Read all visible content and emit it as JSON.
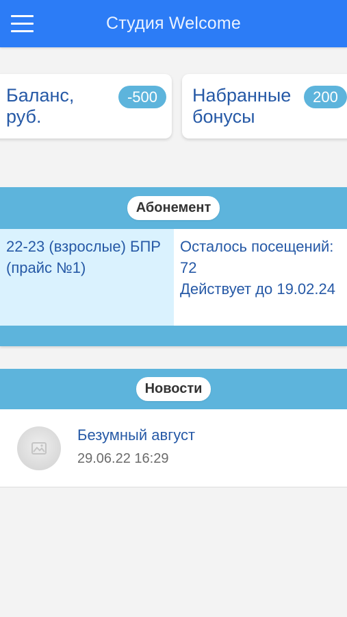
{
  "header": {
    "title": "Студия Welcome",
    "menu_icon": "hamburger-menu-icon",
    "color": "#2c7cf6"
  },
  "balance": {
    "label": "Баланс, руб.",
    "value": "-500"
  },
  "bonuses": {
    "label": "Набранные бонусы",
    "value": "200"
  },
  "subscription": {
    "heading": "Абонемент",
    "name": "22-23 (взрослые) БПР (прайс №1)",
    "visits_left": "Осталось посещений: 72",
    "valid_until": "Действует до 19.02.24"
  },
  "news": {
    "heading": "Новости",
    "items": [
      {
        "title": "Безумный август",
        "date": "29.06.22 16:29",
        "thumbnail_icon": "image-placeholder-icon"
      }
    ]
  },
  "colors": {
    "accent": "#5db4dc",
    "text_primary": "#2659a6",
    "cell_highlight": "#daf2fe"
  }
}
